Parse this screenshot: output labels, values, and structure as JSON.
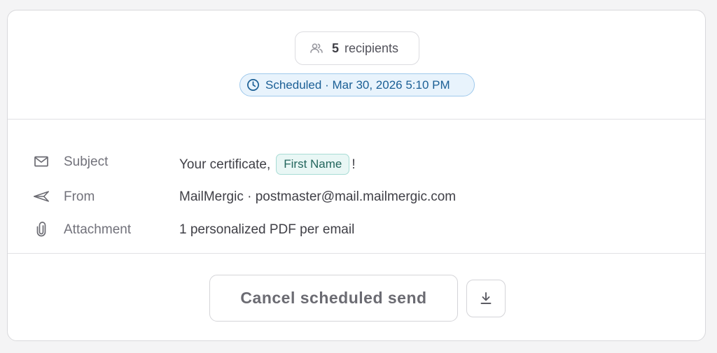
{
  "summary": {
    "recipients_count": "5",
    "recipients_label": "recipients",
    "scheduled_text": "Scheduled · Mar 30, 2026 5:10 PM",
    "recipients_icon": "users-icon",
    "scheduled_icon": "clock-icon"
  },
  "details": {
    "subject": {
      "label": "Subject",
      "value_prefix": "Your certificate,",
      "merge_tag": "First Name",
      "value_suffix": "!",
      "icon": "mail-icon"
    },
    "from": {
      "label": "From",
      "value": "MailMergic · postmaster@mail.mailmergic.com",
      "icon": "send-icon"
    },
    "attachment": {
      "label": "Attachment",
      "value": "1 personalized PDF per email",
      "icon": "paperclip-icon"
    }
  },
  "actions": {
    "cancel_label": "Cancel scheduled send",
    "download_icon": "download-icon"
  },
  "colors": {
    "scheduled_bg": "#e8f3fc",
    "scheduled_border": "#9fc9ec",
    "scheduled_text": "#1b5f95",
    "merge_tag_bg": "#e9f7f5",
    "merge_tag_border": "#a8dcd5",
    "merge_tag_text": "#23665d"
  }
}
